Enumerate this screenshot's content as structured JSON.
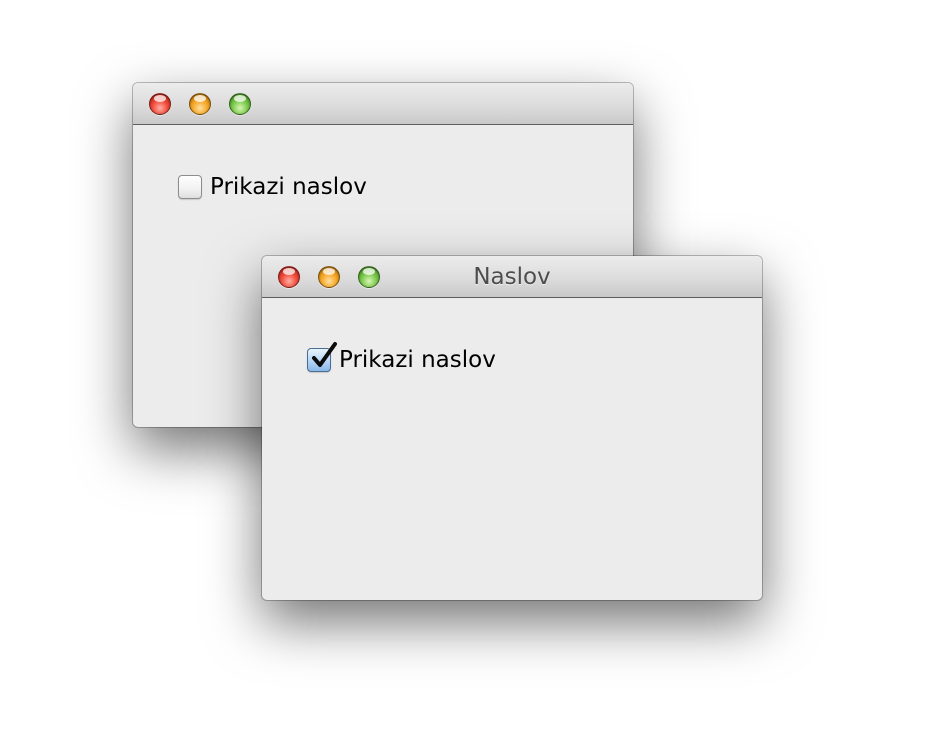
{
  "windows": [
    {
      "title": "",
      "checkbox": {
        "label": "Prikazi naslov",
        "checked": false
      }
    },
    {
      "title": "Naslov",
      "checkbox": {
        "label": "Prikazi naslov",
        "checked": true
      }
    }
  ],
  "traffic_light_colors": {
    "close": "#f04a3a",
    "minimize": "#f5a623",
    "zoom": "#79c84a"
  }
}
